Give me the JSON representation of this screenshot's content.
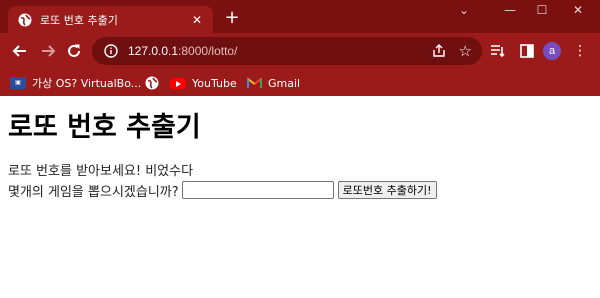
{
  "browser": {
    "tab_title": "로또 번호 추출기",
    "url_host": "127.0.0.1",
    "url_rest": ":8000/lotto/",
    "avatar_letter": "a",
    "bookmarks": [
      {
        "label": "가상 OS? VirtualBo...",
        "icon": "virtualbox-icon"
      },
      {
        "label": "",
        "icon": "globe-icon"
      },
      {
        "label": "YouTube",
        "icon": "youtube-icon"
      },
      {
        "label": "Gmail",
        "icon": "gmail-icon"
      }
    ],
    "colors": {
      "frame": "#8e1414",
      "toolbar": "#9b1b1b",
      "omnibox": "#6f0f0f"
    }
  },
  "page": {
    "heading": "로또 번호 추출기",
    "description": "로또 번호를 받아보세요! 비었수다",
    "form_label": " 몇개의 게임을 뽑으시겠습니까?",
    "input_value": "",
    "submit_label": "로또번호 추출하기!"
  }
}
